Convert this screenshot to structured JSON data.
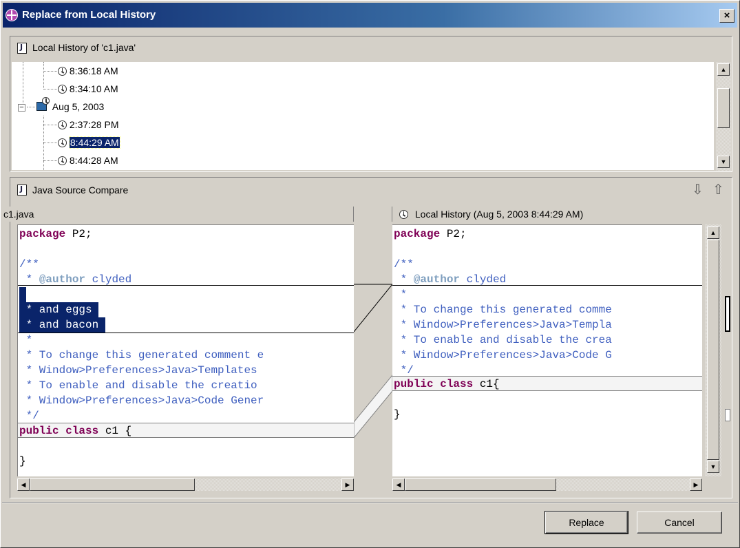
{
  "window": {
    "title": "Replace from Local History",
    "close_glyph": "×"
  },
  "history": {
    "header": "Local History of 'c1.java'",
    "items": [
      {
        "label": "8:36:18 AM"
      },
      {
        "label": "8:34:10 AM"
      },
      {
        "label": "Aug 5, 2003"
      },
      {
        "label": "2:37:28 PM"
      },
      {
        "label": "8:44:29 AM",
        "selected": true
      },
      {
        "label": "8:44:28 AM"
      }
    ],
    "collapse_glyph": "−"
  },
  "compare": {
    "header": "Java Source Compare",
    "next_glyph": "⇩",
    "prev_glyph": "⇧",
    "left_title": "c1.java",
    "right_title": "Local History (Aug 5, 2003 8:44:29 AM)"
  },
  "left_code": {
    "l1_kw": "package",
    "l1_rest": " P2;",
    "l2": "/**",
    "l3_star": " * ",
    "l3_tag": "@author",
    "l3_rest": " clyded",
    "l4": " ",
    "l5": " * and eggs ",
    "l6": " * and bacon ",
    "l7": " *",
    "l8": " * To change this generated comment e",
    "l9": " * Window>Preferences>Java>Templates",
    "l10": " * To enable and disable the creatio",
    "l11": " * Window>Preferences>Java>Code Gener",
    "l12": " */",
    "l13_kw": "public class",
    "l13_rest": " c1 {",
    "l14": "}"
  },
  "right_code": {
    "l1_kw": "package",
    "l1_rest": " P2;",
    "l2": "/**",
    "l3_star": " * ",
    "l3_tag": "@author",
    "l3_rest": " clyded",
    "l4": " *",
    "l5": " * To change this generated comme",
    "l6": " * Window>Preferences>Java>Templa",
    "l7": " * To enable and disable the crea",
    "l8": " * Window>Preferences>Java>Code G",
    "l9": " */",
    "l10_kw": "public class",
    "l10_rest": " c1{",
    "l11": "}"
  },
  "buttons": {
    "replace": "Replace",
    "cancel": "Cancel"
  },
  "icons": {
    "title": "eclipse-icon",
    "java": "java-file-icon",
    "clock": "clock-icon",
    "calendar": "calendar-icon"
  },
  "colors": {
    "titlebar": "#0a246a",
    "selection": "#0a246a",
    "keyword": "#7f0055",
    "comment": "#3f5fbf",
    "javadoc_tag": "#7f9fbf",
    "face": "#d4d0c8"
  }
}
